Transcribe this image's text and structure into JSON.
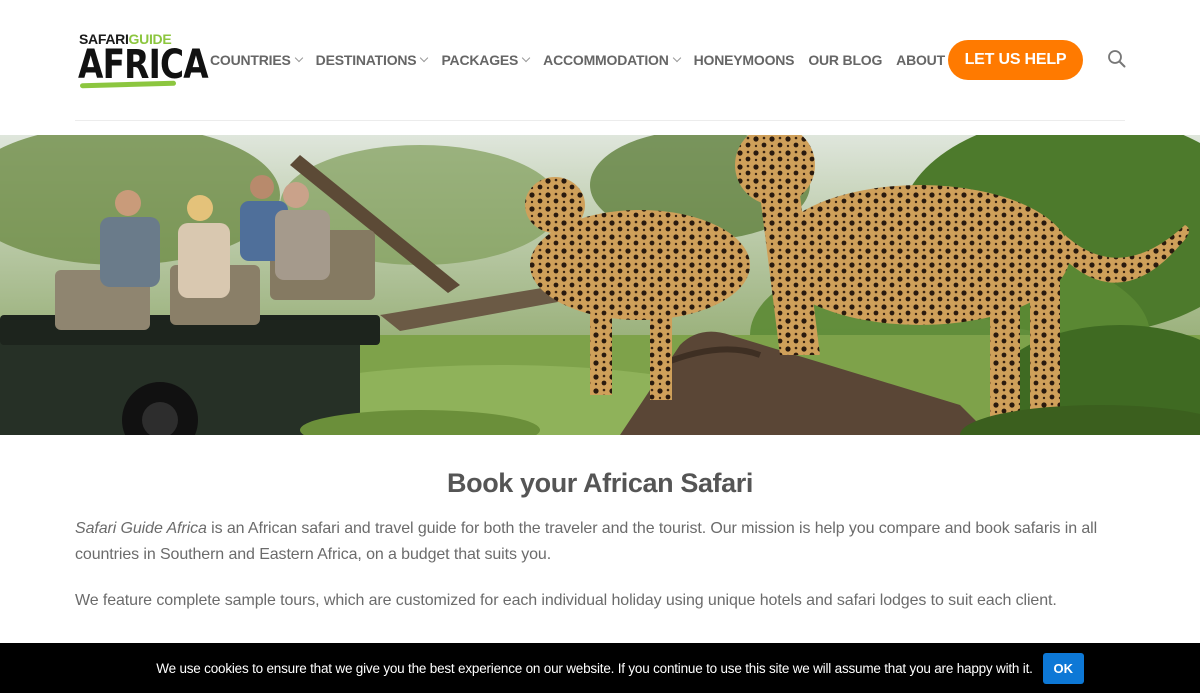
{
  "logo": {
    "top_word_1": "SAFARI",
    "top_word_2": "GUIDE",
    "main": "AFRICA"
  },
  "nav": {
    "items": [
      {
        "label": "COUNTRIES",
        "has_dropdown": true
      },
      {
        "label": "DESTINATIONS",
        "has_dropdown": true
      },
      {
        "label": "PACKAGES",
        "has_dropdown": true
      },
      {
        "label": "ACCOMMODATION",
        "has_dropdown": true
      },
      {
        "label": "HONEYMOONS",
        "has_dropdown": false
      },
      {
        "label": "OUR BLOG",
        "has_dropdown": false
      },
      {
        "label": "ABOUT US",
        "has_dropdown": false
      }
    ],
    "cta_label": "LET US HELP",
    "search_icon": "search-icon"
  },
  "content": {
    "title": "Book your African Safari",
    "para1_em": "Safari Guide Africa",
    "para1_rest": " is an African safari and travel guide for both the traveler and the tourist. Our mission is help you compare and book safaris in all countries in Southern and Eastern Africa, on a budget that suits you.",
    "para2": "We feature complete sample tours, which are customized for each individual holiday using unique hotels and safari lodges to suit each client."
  },
  "cookie": {
    "text": "We use cookies to ensure that we give you the best experience on our website. If you continue to use this site we will assume that you are happy with it.",
    "ok_label": "OK"
  },
  "colors": {
    "accent_orange": "#ff7a00",
    "logo_green": "#8cc63f",
    "ok_blue": "#0d78d6"
  }
}
